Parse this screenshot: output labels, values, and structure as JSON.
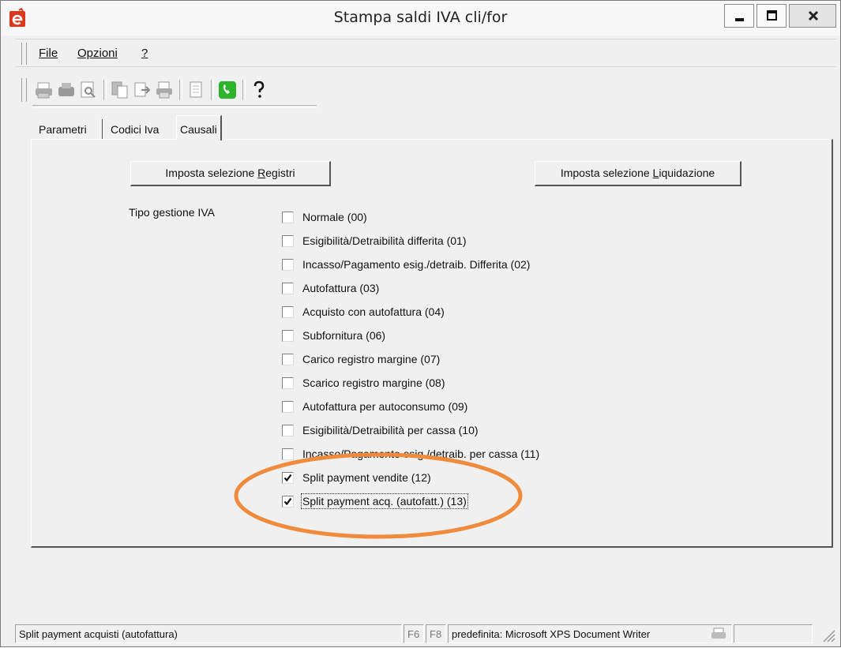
{
  "window": {
    "title": "Stampa saldi IVA cli/for"
  },
  "menu": {
    "items": [
      {
        "label": "File"
      },
      {
        "label": "Opzioni"
      },
      {
        "label": "?"
      }
    ]
  },
  "toolbar": {
    "icons": [
      "print-icon",
      "print-setup-icon",
      "print-preview-icon",
      "copy-icon",
      "export-icon",
      "printer-icon",
      "page-icon",
      "phone-icon",
      "help-icon"
    ]
  },
  "tabs": [
    {
      "label": "Parametri"
    },
    {
      "label": "Codici Iva"
    },
    {
      "label": "Causali",
      "active": true
    }
  ],
  "buttons": {
    "registri_prefix": "Imposta selezione ",
    "registri_accel": "R",
    "registri_suffix": "egistri",
    "liquidazione_prefix": "Imposta selezione ",
    "liquidazione_accel": "L",
    "liquidazione_suffix": "iquidazione"
  },
  "tipo_gestione_label": "Tipo gestione IVA",
  "checkboxes": [
    {
      "label": "Normale (00)",
      "checked": false
    },
    {
      "label": "Esigibilità/Detraibilità differita (01)",
      "checked": false
    },
    {
      "label": "Incasso/Pagamento esig./detraib. Differita (02)",
      "checked": false
    },
    {
      "label": "Autofattura (03)",
      "checked": false
    },
    {
      "label": "Acquisto con autofattura (04)",
      "checked": false
    },
    {
      "label": "Subfornitura (06)",
      "checked": false
    },
    {
      "label": "Carico registro margine (07)",
      "checked": false
    },
    {
      "label": "Scarico registro margine (08)",
      "checked": false
    },
    {
      "label": "Autofattura per autoconsumo (09)",
      "checked": false
    },
    {
      "label": "Esigibilità/Detraibilità per cassa (10)",
      "checked": false
    },
    {
      "label": "Incasso/Pagamento esig./detraib. per cassa (11)",
      "checked": false
    },
    {
      "label": "Split payment vendite (12)",
      "checked": true
    },
    {
      "label": "Split payment acq. (autofatt.) (13)",
      "checked": true
    }
  ],
  "annotation_color": "#f08a3c",
  "statusbar": {
    "message": "Split payment acquisti (autofattura)",
    "key_f6": "F6",
    "key_f8": "F8",
    "printer": "predefinita: Microsoft XPS Document Writer"
  }
}
